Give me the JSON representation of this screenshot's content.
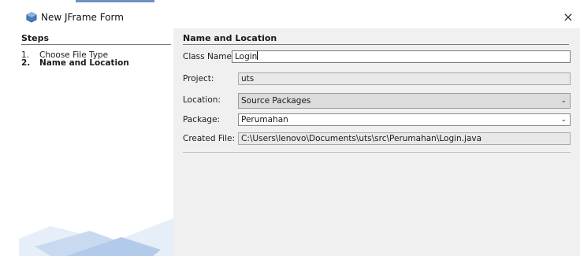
{
  "window": {
    "title": "New JFrame Form",
    "close_glyph": "×",
    "icon": "java-cup-icon"
  },
  "steps": {
    "heading": "Steps",
    "items": [
      {
        "number": "1.",
        "label": "Choose File Type"
      },
      {
        "number": "2.",
        "label": "Name and Location"
      }
    ]
  },
  "form": {
    "heading": "Name and Location",
    "class_name": {
      "label": "Class Name:",
      "value": "Login"
    },
    "project": {
      "label": "Project:",
      "value": "uts"
    },
    "location": {
      "label": "Location:",
      "value": "Source Packages"
    },
    "package": {
      "label": "Package:",
      "value": "Perumahan"
    },
    "created_file": {
      "label": "Created File:",
      "value": "C:\\Users\\lenovo\\Documents\\uts\\src\\Perumahan\\Login.java"
    }
  },
  "colors": {
    "dialog_bg": "#f0f0f0",
    "steps_bg": "#ffffff",
    "accent": "#6e8fc2"
  }
}
